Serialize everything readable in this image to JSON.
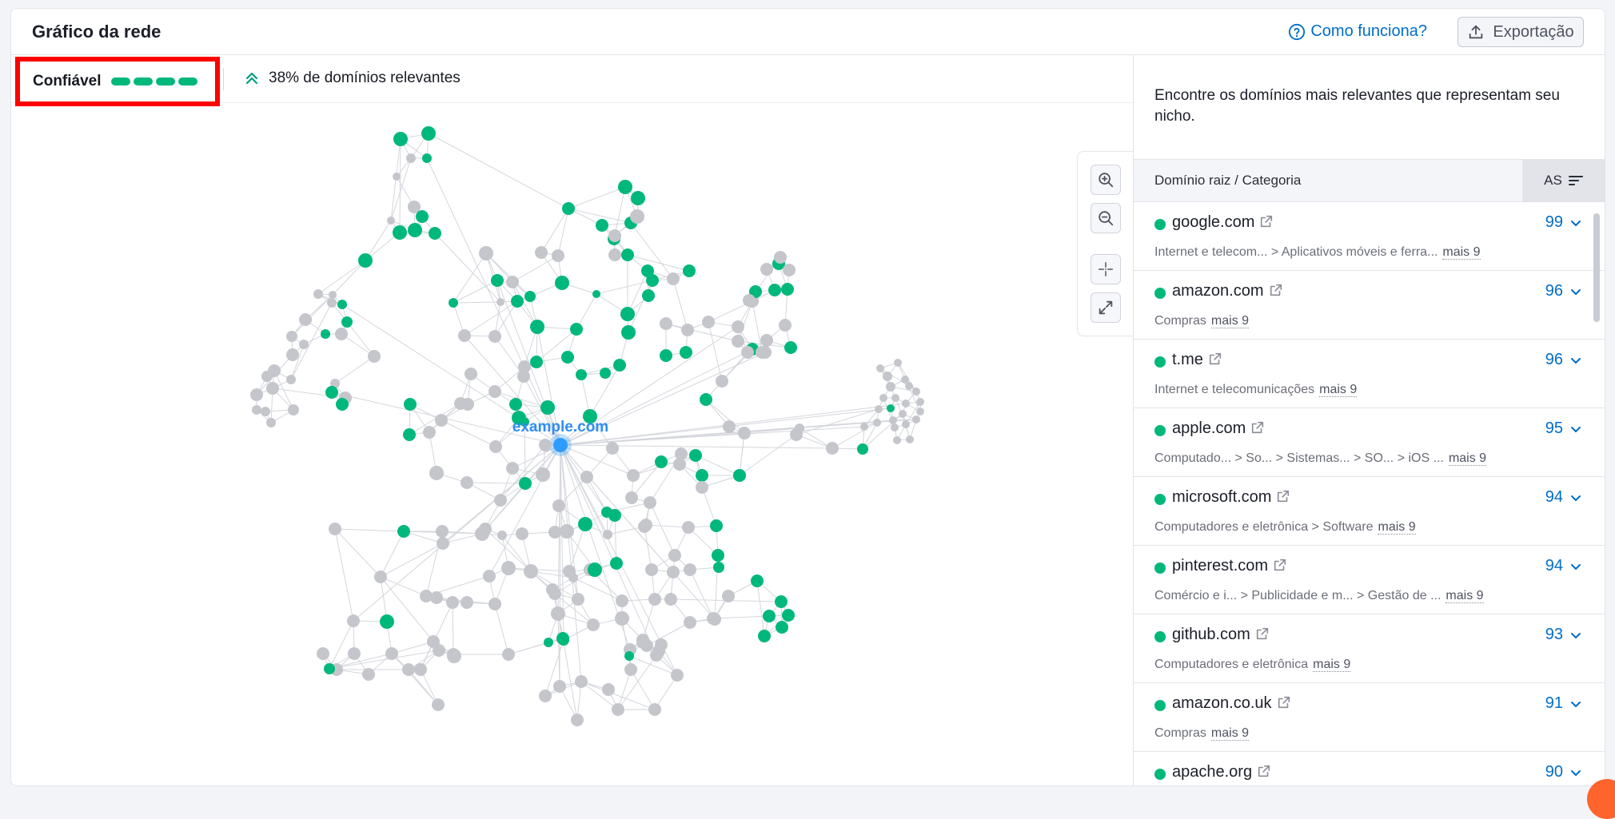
{
  "header": {
    "title": "Gráfico da rede",
    "help_link": "Como funciona?",
    "export_label": "Exportação"
  },
  "toolbar": {
    "confidence_label": "Confiável",
    "confidence_level": 4,
    "confidence_max": 4,
    "relevant_text": "38% de domínios relevantes"
  },
  "graph": {
    "center_label": "example.com"
  },
  "sidebar": {
    "intro": "Encontre os domínios mais relevantes que representam seu nicho.",
    "col_domain": "Domínio raiz / Categoria",
    "col_score": "AS",
    "rows": [
      {
        "domain": "google.com",
        "categories": "Internet e telecom... > Aplicativos móveis e ferra...",
        "more": "mais 9",
        "score": "99"
      },
      {
        "domain": "amazon.com",
        "categories": "Compras",
        "more": "mais 9",
        "score": "96"
      },
      {
        "domain": "t.me",
        "categories": "Internet e telecomunicações",
        "more": "mais 9",
        "score": "96"
      },
      {
        "domain": "apple.com",
        "categories": "Computado... > So... > Sistemas... > SO... > iOS ...",
        "more": "mais 9",
        "score": "95"
      },
      {
        "domain": "microsoft.com",
        "categories": "Computadores e eletrônica > Software",
        "more": "mais 9",
        "score": "94"
      },
      {
        "domain": "pinterest.com",
        "categories": "Comércio e i...  > Publicidade e m... > Gestão de ...",
        "more": "mais 9",
        "score": "94"
      },
      {
        "domain": "github.com",
        "categories": "Computadores e eletrônica",
        "more": "mais 9",
        "score": "93"
      },
      {
        "domain": "amazon.co.uk",
        "categories": "Compras",
        "more": "mais 9",
        "score": "91"
      },
      {
        "domain": "apache.org",
        "categories": "",
        "more": "",
        "score": "90"
      }
    ]
  },
  "colors": {
    "green": "#00b87c",
    "gray": "#c4c6cc",
    "blue": "#2e9cff",
    "link": "#006dca"
  }
}
